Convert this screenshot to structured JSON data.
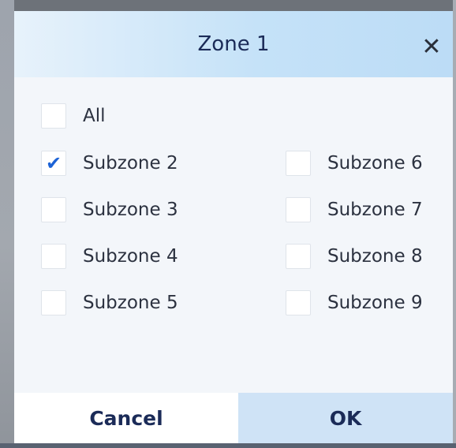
{
  "dialog": {
    "title": "Zone 1",
    "close_glyph": "✕",
    "check_glyph": "✔"
  },
  "options": {
    "all": {
      "label": "All",
      "checked": false
    },
    "subzone2": {
      "label": "Subzone 2",
      "checked": true
    },
    "subzone3": {
      "label": "Subzone 3",
      "checked": false
    },
    "subzone4": {
      "label": "Subzone 4",
      "checked": false
    },
    "subzone5": {
      "label": "Subzone 5",
      "checked": false
    },
    "subzone6": {
      "label": "Subzone 6",
      "checked": false
    },
    "subzone7": {
      "label": "Subzone 7",
      "checked": false
    },
    "subzone8": {
      "label": "Subzone 8",
      "checked": false
    },
    "subzone9": {
      "label": "Subzone 9",
      "checked": false
    }
  },
  "footer": {
    "cancel_label": "Cancel",
    "ok_label": "OK"
  },
  "colors": {
    "accent": "#1d63d6",
    "title_text": "#1b2b58",
    "header_gradient_end": "#bcdcf6",
    "ok_button_bg": "#cfe3f6"
  }
}
